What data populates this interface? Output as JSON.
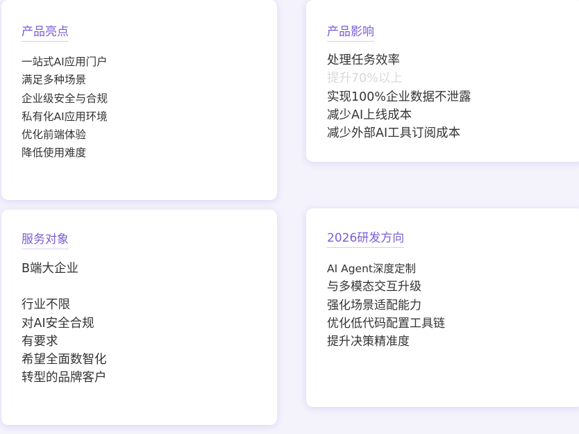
{
  "cards": {
    "highlights": {
      "title": "产品亮点",
      "lines": [
        "一站式AI应用门户",
        "满足多种场景",
        "企业级安全与合规",
        "私有化AI应用环境",
        "优化前端体验",
        "降低使用难度"
      ]
    },
    "impact": {
      "title": "产品影响",
      "lines": [
        "处理任务效率",
        "提升70%以上",
        "实现100%企业数据不泄露",
        "减少AI上线成本",
        "减少外部AI工具订阅成本"
      ]
    },
    "audience": {
      "title": "服务对象",
      "lines": [
        "B端大企业",
        "",
        "行业不限",
        "对AI安全合规",
        "有要求",
        "希望全面数智化",
        "转型的品牌客户"
      ]
    },
    "roadmap": {
      "title": "2026研发方向",
      "lines": [
        "AI Agent深度定制",
        "与多模态交互升级",
        "强化场景适配能力",
        "优化低代码配置工具链",
        "提升决策精准度"
      ]
    }
  },
  "colors": {
    "accent": "#7b5cd6",
    "text": "#333333",
    "faded_text": "#d8d8dc",
    "card_background": "#ffffff",
    "page_background": "#f4f2fb"
  }
}
